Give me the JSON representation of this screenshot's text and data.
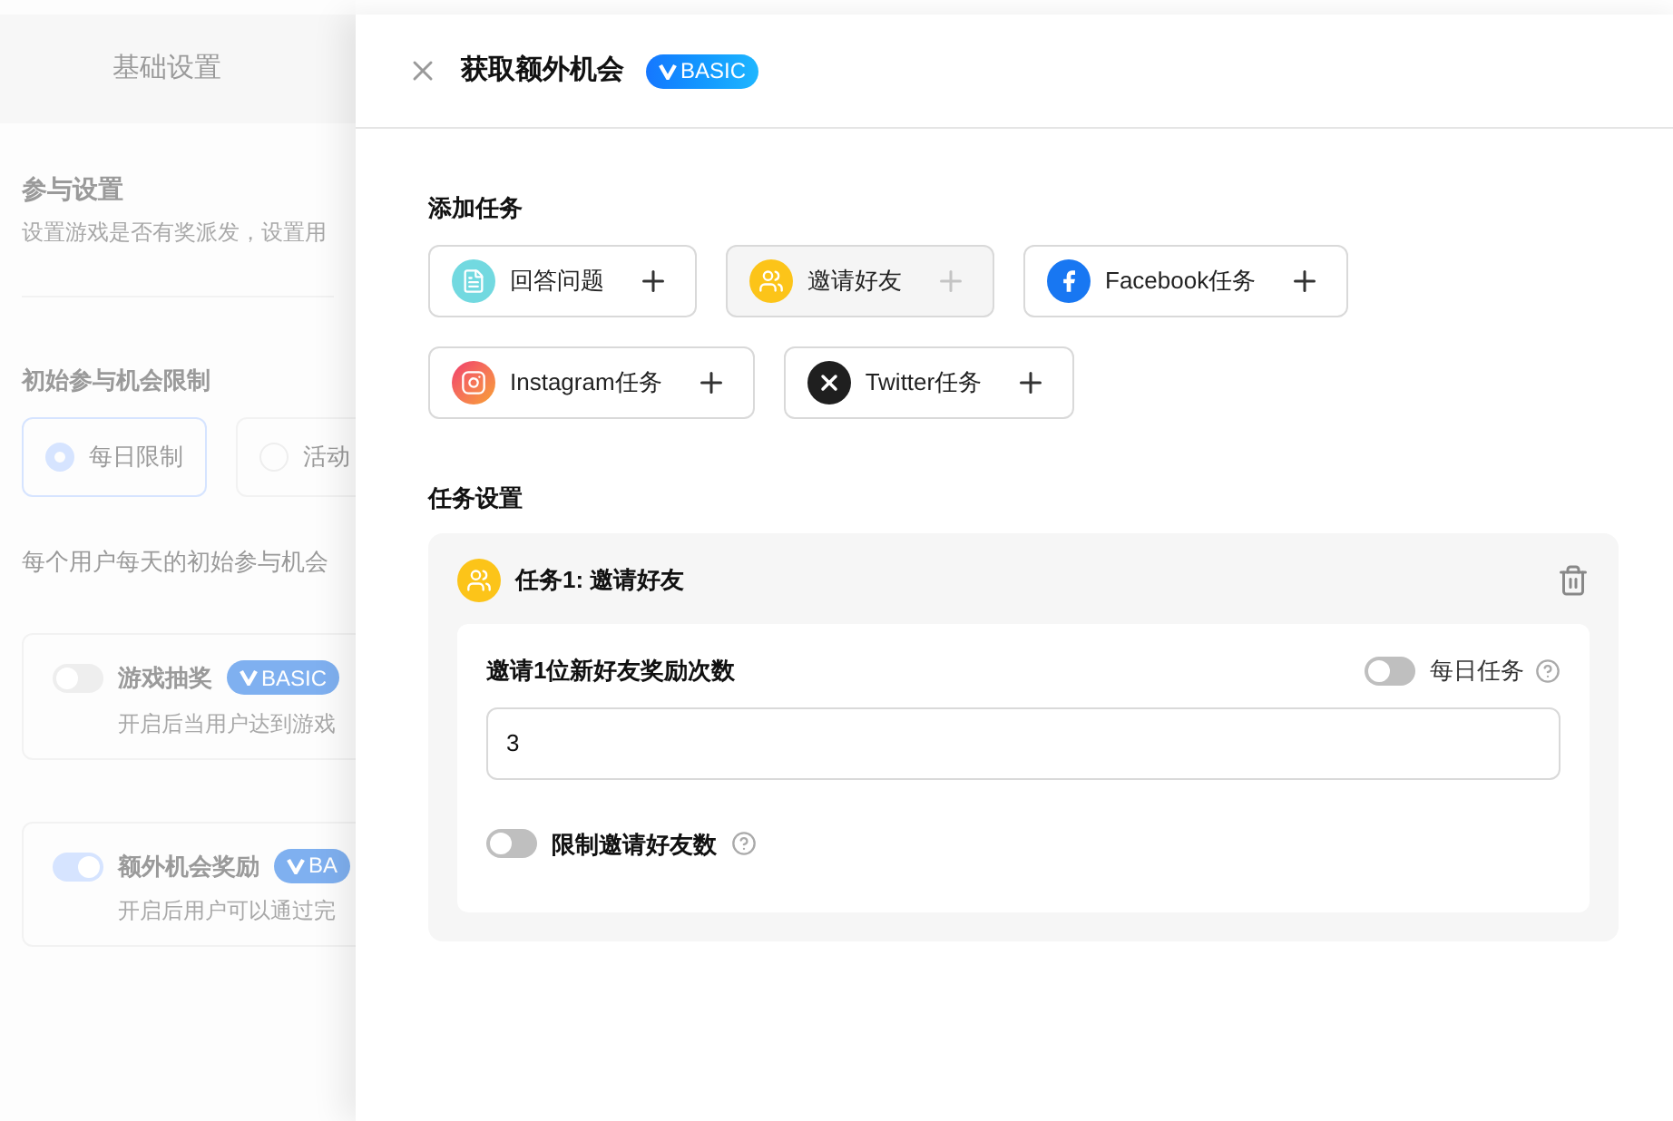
{
  "background": {
    "tab": "基础设置",
    "section_title": "参与设置",
    "section_desc": "设置游戏是否有奖派发，设置用",
    "limit_label": "初始参与机会限制",
    "radios": [
      {
        "label": "每日限制",
        "selected": true
      },
      {
        "label": "活动",
        "selected": false
      }
    ],
    "limit_desc": "每个用户每天的初始参与机会",
    "cards": [
      {
        "title": "游戏抽奖",
        "badge": "BASIC",
        "desc": "开启后当用户达到游戏",
        "on": false
      },
      {
        "title": "额外机会奖励",
        "badge": "BA",
        "desc": "开启后用户可以通过完",
        "on": true
      }
    ]
  },
  "drawer": {
    "title": "获取额外机会",
    "badge": "BASIC",
    "add_tasks_label": "添加任务",
    "tasks": [
      {
        "kind": "question",
        "label": "回答问题",
        "disabled": false
      },
      {
        "kind": "invite",
        "label": "邀请好友",
        "disabled": true
      },
      {
        "kind": "facebook",
        "label": "Facebook任务",
        "disabled": false
      },
      {
        "kind": "instagram",
        "label": "Instagram任务",
        "disabled": false
      },
      {
        "kind": "twitter",
        "label": "Twitter任务",
        "disabled": false
      }
    ],
    "settings_label": "任务设置",
    "task_card": {
      "kind": "invite",
      "title": "任务1: 邀请好友",
      "field_label": "邀请1位新好友奖励次数",
      "daily": {
        "label": "每日任务",
        "on": false
      },
      "value": "3",
      "limit": {
        "label": "限制邀请好友数",
        "on": false
      }
    }
  }
}
